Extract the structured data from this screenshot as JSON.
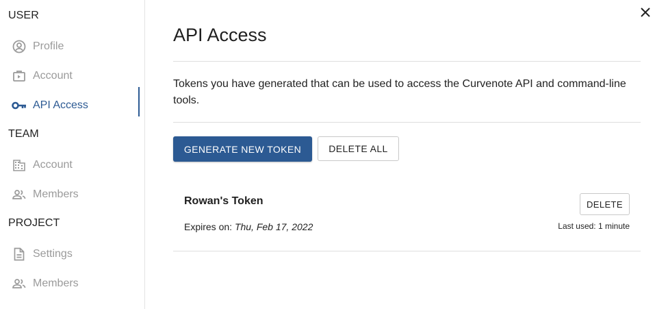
{
  "sidebar": {
    "sections": [
      {
        "title": "USER"
      },
      {
        "title": "TEAM"
      },
      {
        "title": "PROJECT"
      }
    ],
    "items": [
      {
        "label": "Profile",
        "icon": "profile-icon"
      },
      {
        "label": "Account",
        "icon": "account-icon"
      },
      {
        "label": "API Access",
        "icon": "key-icon",
        "active": true
      },
      {
        "label": "Account",
        "icon": "building-icon"
      },
      {
        "label": "Members",
        "icon": "members-icon"
      },
      {
        "label": "Settings",
        "icon": "document-icon"
      },
      {
        "label": "Members",
        "icon": "members-icon"
      }
    ]
  },
  "main": {
    "title": "API Access",
    "description": "Tokens you have generated that can be used to access the Curvenote API and command-line tools.",
    "buttons": {
      "generate": "GENERATE NEW TOKEN",
      "delete_all": "DELETE ALL"
    },
    "tokens": [
      {
        "name": "Rowan's Token",
        "expires_label": "Expires on:",
        "expires_date": "Thu, Feb 17, 2022",
        "delete_label": "DELETE",
        "last_used": "Last used: 1 minute"
      }
    ]
  },
  "colors": {
    "accent": "#2c5a93",
    "muted_text": "#9a9a9a"
  }
}
